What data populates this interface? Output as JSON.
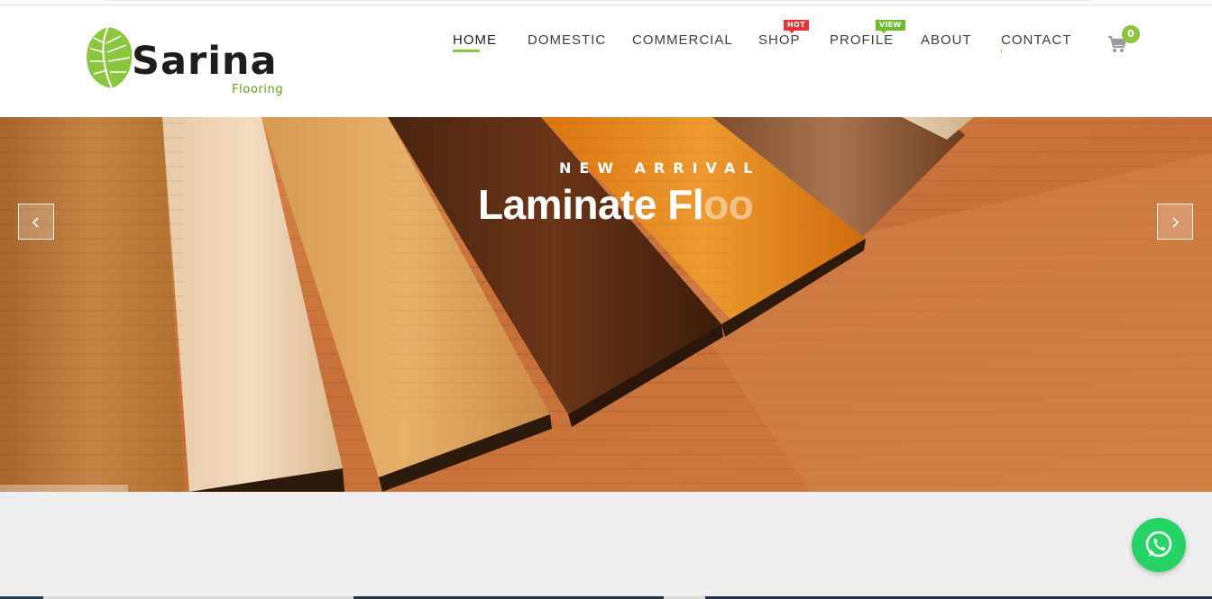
{
  "brand": {
    "name": "Sarina",
    "tagline": "Flooring",
    "accent_color": "#8cc63f"
  },
  "nav": {
    "items": [
      {
        "label": "HOME",
        "active": true
      },
      {
        "label": "DOMESTIC"
      },
      {
        "label": "COMMERCIAL"
      },
      {
        "label": "SHOP",
        "badge": "HOT",
        "badge_color": "#e53333"
      },
      {
        "label": "PROFILE",
        "badge": "VIEW",
        "badge_color": "#6bbd2f"
      },
      {
        "label": "ABOUT"
      },
      {
        "label": "CONTACT"
      }
    ],
    "cart": {
      "icon": "shopping-cart-icon",
      "count": "0"
    }
  },
  "hero": {
    "eyebrow": "NEW ARRIVAL",
    "title_visible": "Laminate Fl",
    "title_fading": "oo",
    "prev_icon": "chevron-left-icon",
    "next_icon": "chevron-right-icon"
  },
  "chat": {
    "icon": "whatsapp-icon",
    "color": "#25d366"
  }
}
